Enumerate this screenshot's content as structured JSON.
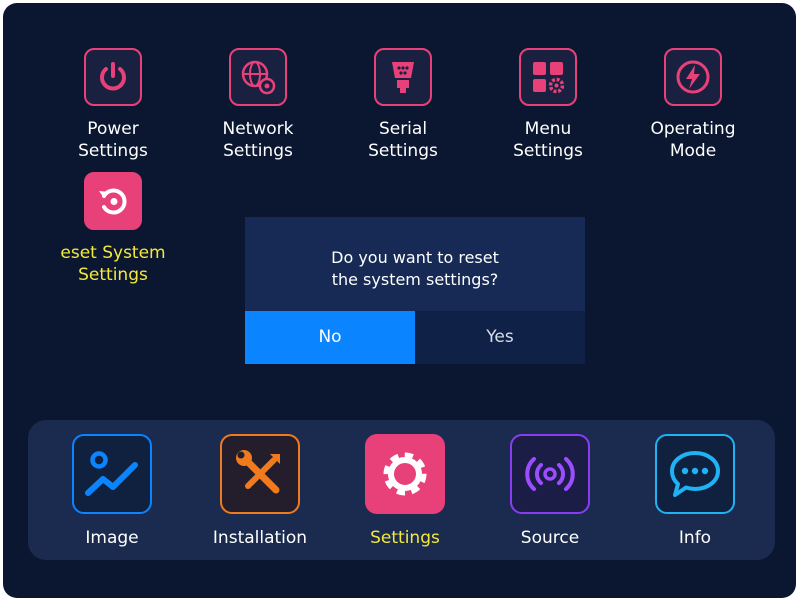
{
  "settings_menu": {
    "items": [
      {
        "label": "Power\nSettings",
        "icon": "power-icon"
      },
      {
        "label": "Network\nSettings",
        "icon": "network-globe-gear-icon"
      },
      {
        "label": "Serial\nSettings",
        "icon": "serial-port-icon"
      },
      {
        "label": "Menu\nSettings",
        "icon": "menu-grid-gear-icon"
      },
      {
        "label": "Operating\nMode",
        "icon": "lightning-icon"
      },
      {
        "label": "eset System\nSettings",
        "icon": "reset-icon"
      }
    ]
  },
  "dialog": {
    "message": "Do you want to reset\nthe system settings?",
    "no_label": "No",
    "yes_label": "Yes"
  },
  "bottom_nav": {
    "items": [
      {
        "label": "Image",
        "icon": "image-chart-icon"
      },
      {
        "label": "Installation",
        "icon": "tools-icon"
      },
      {
        "label": "Settings",
        "icon": "gear-icon"
      },
      {
        "label": "Source",
        "icon": "signal-source-icon"
      },
      {
        "label": "Info",
        "icon": "chat-bubble-icon"
      }
    ]
  },
  "colors": {
    "background": "#0b1730",
    "settings_accent": "#e8417a",
    "highlight_text": "#f5ea3a",
    "selected_button": "#0a84ff"
  }
}
